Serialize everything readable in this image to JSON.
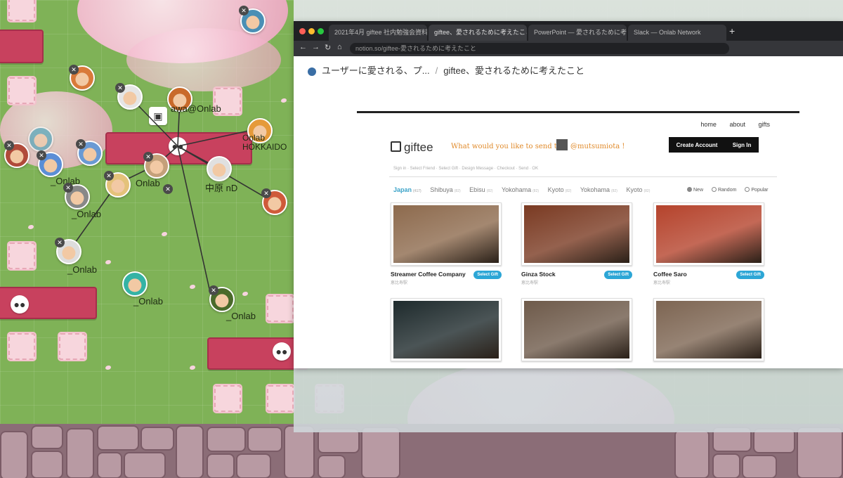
{
  "browser": {
    "tabs": [
      "2021年4月 giftee 社内勉強会資料",
      "giftee、愛されるために考えたこと",
      "PowerPoint — 愛されるために考えたこと",
      "Slack — Onlab Network"
    ],
    "new_tab_symbol": "+",
    "url": "notion.so/giftee-愛されるために考えたこと"
  },
  "breadcrumb": {
    "parent": "ユーザーに愛される、プ...",
    "separator": "/",
    "current": "giftee、愛されるために考えたこと"
  },
  "site": {
    "nav": [
      "home",
      "about",
      "gifts"
    ],
    "logo": "giftee",
    "tagline": "What would you like to send to",
    "tag_handle": "@mutsumiota !",
    "create_account": "Create Account",
    "sign_in": "Sign In",
    "steps": "Sign in  ·  Select Friend  ·  Select Gift  ·  Design Message  ·  Checkout  ·  Send  ·  OK",
    "cities": [
      {
        "name": "Japan",
        "count": "(417)"
      },
      {
        "name": "Shibuya",
        "count": "(82)"
      },
      {
        "name": "Ebisu",
        "count": "(82)"
      },
      {
        "name": "Yokohama",
        "count": "(82)"
      },
      {
        "name": "Kyoto",
        "count": "(82)"
      },
      {
        "name": "Yokohama",
        "count": "(82)"
      },
      {
        "name": "Kyoto",
        "count": "(82)"
      }
    ],
    "sorts": [
      "New",
      "Random",
      "Popular"
    ],
    "select_gift": "Select Gift",
    "cards": [
      {
        "name": "Streamer Coffee Company",
        "area": "恵比寿駅",
        "photo_color": "#8d6a4d"
      },
      {
        "name": "Ginza Stock",
        "area": "恵比寿駅",
        "photo_color": "#7a3a22"
      },
      {
        "name": "Coffee Saro",
        "area": "恵比寿駅",
        "photo_color": "#b5432c"
      },
      {
        "name": "",
        "area": "",
        "photo_color": "#1e2a2c"
      },
      {
        "name": "",
        "area": "",
        "photo_color": "#6e5a4a"
      },
      {
        "name": "",
        "area": "",
        "photo_color": "#7d6552"
      }
    ]
  },
  "world": {
    "avatars": [
      {
        "label": "",
        "color": "#4a8fb5"
      },
      {
        "label": "",
        "color": "#d97a3a"
      },
      {
        "label": "",
        "color": "#ddd"
      },
      {
        "label": "awa@Onlab",
        "color": "#c96a2a"
      },
      {
        "label": "",
        "color": "#6a9ad4"
      },
      {
        "label": "Onlab HOKKAIDO",
        "color": "#e59a3a"
      },
      {
        "label": "",
        "color": "#b04a3a"
      },
      {
        "label": "_Onlab",
        "color": "#5b8ed6"
      },
      {
        "label": "",
        "color": "#e4c27a"
      },
      {
        "label": "Onlab",
        "color": "#c4a07a"
      },
      {
        "label": "中原 nD",
        "color": "#e0e0e0"
      },
      {
        "label": "_Onlab",
        "color": "#888"
      },
      {
        "label": "",
        "color": "#cf5a3a"
      },
      {
        "label": "_Onlab",
        "color": "#ddd"
      },
      {
        "label": "_Onlab",
        "color": "#34b3a5"
      },
      {
        "label": "_Onlab",
        "color": "#4a6a2a"
      },
      {
        "label": "",
        "color": "#3a9ab5"
      }
    ]
  }
}
